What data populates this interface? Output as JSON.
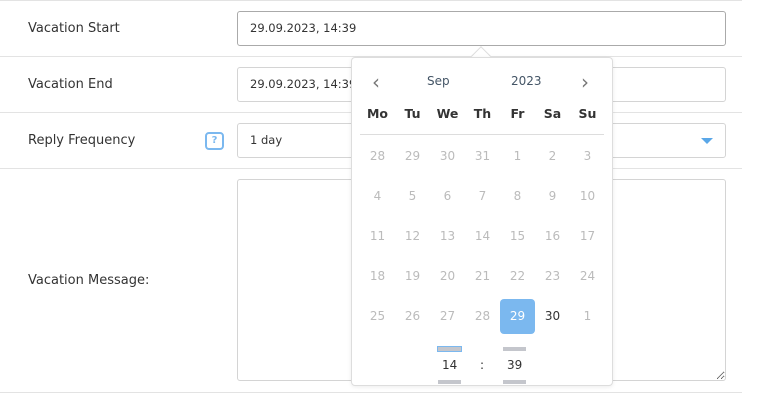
{
  "form": {
    "vacation_start": {
      "label": "Vacation Start",
      "value": "29.09.2023, 14:39"
    },
    "vacation_end": {
      "label": "Vacation End",
      "value": "29.09.2023, 14:39"
    },
    "reply_frequency": {
      "label": "Reply Frequency",
      "value": "1 day",
      "help": "?"
    },
    "vacation_message": {
      "label": "Vacation Message:",
      "value": ""
    }
  },
  "datepicker": {
    "month": "Sep",
    "year": "2023",
    "weekdays": [
      "Mo",
      "Tu",
      "We",
      "Th",
      "Fr",
      "Sa",
      "Su"
    ],
    "days": [
      {
        "d": "28",
        "s": "other"
      },
      {
        "d": "29",
        "s": "other"
      },
      {
        "d": "30",
        "s": "other"
      },
      {
        "d": "31",
        "s": "other"
      },
      {
        "d": "1",
        "s": "disabled"
      },
      {
        "d": "2",
        "s": "disabled"
      },
      {
        "d": "3",
        "s": "disabled"
      },
      {
        "d": "4",
        "s": "disabled"
      },
      {
        "d": "5",
        "s": "disabled"
      },
      {
        "d": "6",
        "s": "disabled"
      },
      {
        "d": "7",
        "s": "disabled"
      },
      {
        "d": "8",
        "s": "disabled"
      },
      {
        "d": "9",
        "s": "disabled"
      },
      {
        "d": "10",
        "s": "disabled"
      },
      {
        "d": "11",
        "s": "disabled"
      },
      {
        "d": "12",
        "s": "disabled"
      },
      {
        "d": "13",
        "s": "disabled"
      },
      {
        "d": "14",
        "s": "disabled"
      },
      {
        "d": "15",
        "s": "disabled"
      },
      {
        "d": "16",
        "s": "disabled"
      },
      {
        "d": "17",
        "s": "disabled"
      },
      {
        "d": "18",
        "s": "disabled"
      },
      {
        "d": "19",
        "s": "disabled"
      },
      {
        "d": "20",
        "s": "disabled"
      },
      {
        "d": "21",
        "s": "disabled"
      },
      {
        "d": "22",
        "s": "disabled"
      },
      {
        "d": "23",
        "s": "disabled"
      },
      {
        "d": "24",
        "s": "disabled"
      },
      {
        "d": "25",
        "s": "disabled"
      },
      {
        "d": "26",
        "s": "disabled"
      },
      {
        "d": "27",
        "s": "disabled"
      },
      {
        "d": "28",
        "s": "disabled"
      },
      {
        "d": "29",
        "s": "selected"
      },
      {
        "d": "30",
        "s": "current"
      },
      {
        "d": "1",
        "s": "other"
      }
    ],
    "hour": "14",
    "separator": ":",
    "minute": "39",
    "accent": "#7bb8ef"
  }
}
